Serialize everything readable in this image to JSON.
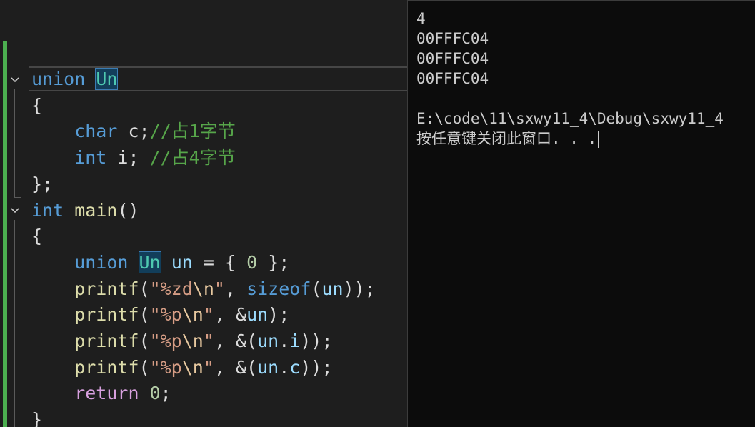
{
  "editor": {
    "lines": [
      {
        "tokens": [
          {
            "t": "union",
            "c": "kw"
          },
          {
            "t": " ",
            "c": "pl"
          },
          {
            "t": "Un",
            "c": "ty",
            "hl": true
          }
        ]
      },
      {
        "tokens": [
          {
            "t": "{",
            "c": "pl"
          }
        ]
      },
      {
        "tokens": [
          {
            "t": "    char",
            "c": "kw"
          },
          {
            "t": " c;",
            "c": "pl"
          },
          {
            "t": "//占1字节",
            "c": "cm"
          }
        ]
      },
      {
        "tokens": [
          {
            "t": "    int",
            "c": "kw"
          },
          {
            "t": " i; ",
            "c": "pl"
          },
          {
            "t": "//占4字节",
            "c": "cm"
          }
        ]
      },
      {
        "tokens": [
          {
            "t": "};",
            "c": "pl"
          }
        ]
      },
      {
        "tokens": [
          {
            "t": "int",
            "c": "kw"
          },
          {
            "t": " ",
            "c": "pl"
          },
          {
            "t": "main",
            "c": "fn"
          },
          {
            "t": "()",
            "c": "pl"
          }
        ]
      },
      {
        "tokens": [
          {
            "t": "{",
            "c": "pl"
          }
        ]
      },
      {
        "tokens": [
          {
            "t": "    union",
            "c": "kw"
          },
          {
            "t": " ",
            "c": "pl"
          },
          {
            "t": "Un",
            "c": "ty",
            "hl": true
          },
          {
            "t": " ",
            "c": "pl"
          },
          {
            "t": "un",
            "c": "var"
          },
          {
            "t": " = { ",
            "c": "pl"
          },
          {
            "t": "0",
            "c": "num"
          },
          {
            "t": " };",
            "c": "pl"
          }
        ]
      },
      {
        "tokens": [
          {
            "t": "    printf",
            "c": "fn"
          },
          {
            "t": "(",
            "c": "pl"
          },
          {
            "t": "\"%zd",
            "c": "str"
          },
          {
            "t": "\\n",
            "c": "esc"
          },
          {
            "t": "\"",
            "c": "str"
          },
          {
            "t": ", ",
            "c": "pl"
          },
          {
            "t": "sizeof",
            "c": "kw"
          },
          {
            "t": "(",
            "c": "pl"
          },
          {
            "t": "un",
            "c": "var"
          },
          {
            "t": "));",
            "c": "pl"
          }
        ]
      },
      {
        "tokens": [
          {
            "t": "    printf",
            "c": "fn"
          },
          {
            "t": "(",
            "c": "pl"
          },
          {
            "t": "\"%p",
            "c": "str"
          },
          {
            "t": "\\n",
            "c": "esc"
          },
          {
            "t": "\"",
            "c": "str"
          },
          {
            "t": ", &",
            "c": "pl"
          },
          {
            "t": "un",
            "c": "var"
          },
          {
            "t": ");",
            "c": "pl"
          }
        ]
      },
      {
        "tokens": [
          {
            "t": "    printf",
            "c": "fn"
          },
          {
            "t": "(",
            "c": "pl"
          },
          {
            "t": "\"%p",
            "c": "str"
          },
          {
            "t": "\\n",
            "c": "esc"
          },
          {
            "t": "\"",
            "c": "str"
          },
          {
            "t": ", &(",
            "c": "pl"
          },
          {
            "t": "un",
            "c": "var"
          },
          {
            "t": ".",
            "c": "pl"
          },
          {
            "t": "i",
            "c": "var"
          },
          {
            "t": "));",
            "c": "pl"
          }
        ]
      },
      {
        "tokens": [
          {
            "t": "    printf",
            "c": "fn"
          },
          {
            "t": "(",
            "c": "pl"
          },
          {
            "t": "\"%p",
            "c": "str"
          },
          {
            "t": "\\n",
            "c": "esc"
          },
          {
            "t": "\"",
            "c": "str"
          },
          {
            "t": ", &(",
            "c": "pl"
          },
          {
            "t": "un",
            "c": "var"
          },
          {
            "t": ".",
            "c": "pl"
          },
          {
            "t": "c",
            "c": "var"
          },
          {
            "t": "));",
            "c": "pl"
          }
        ]
      },
      {
        "tokens": [
          {
            "t": "    return",
            "c": "kw2"
          },
          {
            "t": " ",
            "c": "pl"
          },
          {
            "t": "0",
            "c": "num"
          },
          {
            "t": ";",
            "c": "pl"
          }
        ]
      },
      {
        "tokens": [
          {
            "t": "}",
            "c": "pl"
          }
        ]
      }
    ],
    "colors": {
      "change_bar": "#4caf50",
      "keyword": "#569cd6",
      "type": "#4ec9b0",
      "function": "#dcdcaa",
      "string": "#d69d85",
      "comment": "#57a64a",
      "control_keyword": "#d8a0df"
    }
  },
  "console": {
    "lines": [
      "4",
      "00FFFC04",
      "00FFFC04",
      "00FFFC04",
      "",
      "E:\\code\\11\\sxwy11_4\\Debug\\sxwy11_4",
      "按任意键关闭此窗口. . ."
    ],
    "background": "#0c0c0c"
  }
}
